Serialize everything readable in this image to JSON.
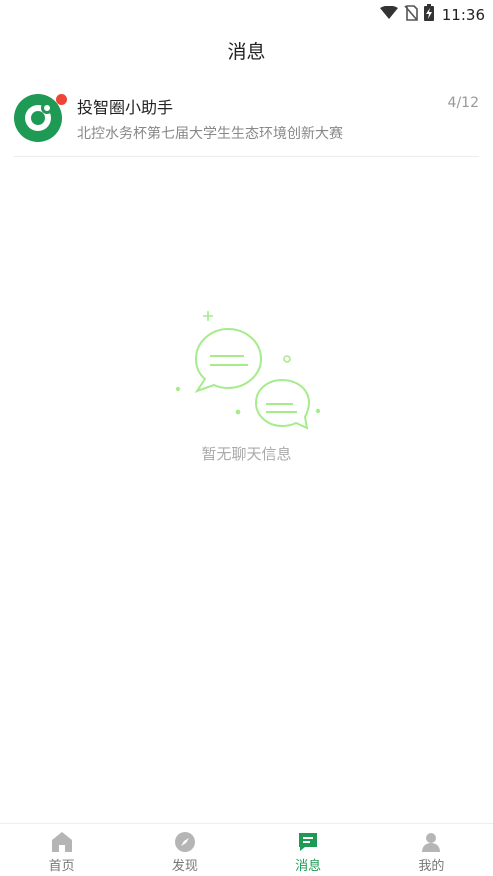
{
  "status_bar": {
    "time": "11:36",
    "icons": [
      "wifi-icon",
      "no-sim-icon",
      "battery-charging-icon"
    ]
  },
  "header": {
    "title": "消息"
  },
  "conversations": [
    {
      "name": "投智圈小助手",
      "date": "4/12",
      "preview": "北控水务杯第七届大学生生态环境创新大赛",
      "unread": true,
      "avatar": "logo-avatar-icon"
    }
  ],
  "empty_state": {
    "text": "暂无聊天信息",
    "icon": "chat-bubbles-icon"
  },
  "bottom_nav": {
    "items": [
      {
        "label": "首页",
        "icon": "home-icon",
        "active": false
      },
      {
        "label": "发现",
        "icon": "compass-icon",
        "active": false
      },
      {
        "label": "消息",
        "icon": "message-icon",
        "active": true
      },
      {
        "label": "我的",
        "icon": "user-icon",
        "active": false
      }
    ]
  },
  "colors": {
    "accent": "#1e9a54",
    "unread_dot": "#f04438",
    "illustration": "#a6ec8c"
  }
}
